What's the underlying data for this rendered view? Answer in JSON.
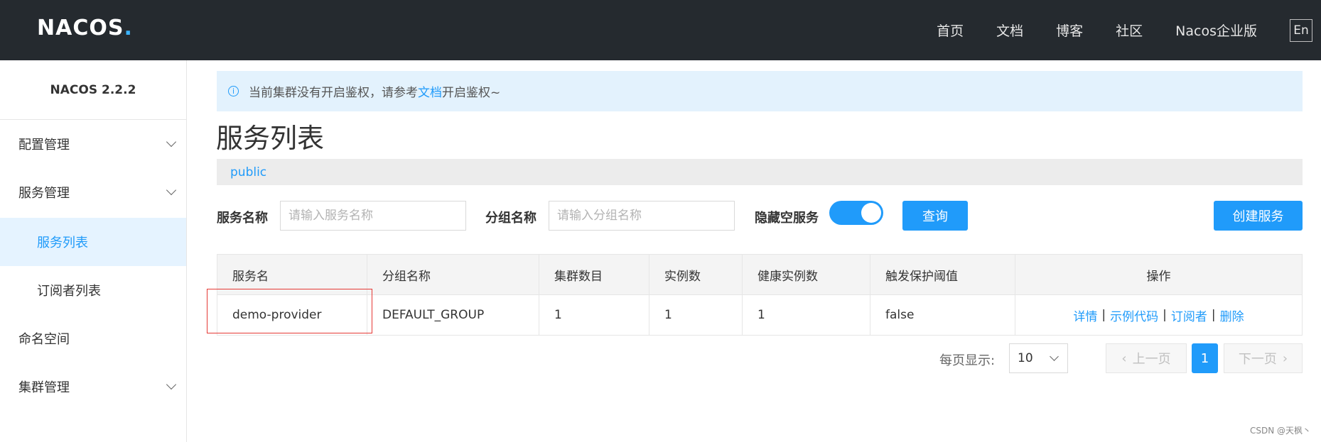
{
  "header": {
    "logo_text": "NACOS",
    "logo_dot": ".",
    "nav": [
      "首页",
      "文档",
      "博客",
      "社区",
      "Nacos企业版"
    ],
    "lang": "En"
  },
  "sidebar": {
    "version": "NACOS 2.2.2",
    "items": [
      {
        "label": "配置管理",
        "expandable": true
      },
      {
        "label": "服务管理",
        "expandable": true
      },
      {
        "label": "服务列表",
        "active": true
      },
      {
        "label": "订阅者列表"
      },
      {
        "label": "命名空间"
      },
      {
        "label": "集群管理",
        "expandable": true
      }
    ]
  },
  "notice": {
    "before": "当前集群没有开启鉴权，请参考",
    "link": "文档",
    "after": "开启鉴权~"
  },
  "page_title": "服务列表",
  "namespace": "public",
  "filters": {
    "service_name_label": "服务名称",
    "service_name_placeholder": "请输入服务名称",
    "group_name_label": "分组名称",
    "group_name_placeholder": "请输入分组名称",
    "hide_empty_label": "隐藏空服务",
    "hide_empty_on": true,
    "query_button": "查询",
    "create_button": "创建服务"
  },
  "table": {
    "headers": [
      "服务名",
      "分组名称",
      "集群数目",
      "实例数",
      "健康实例数",
      "触发保护阈值",
      "操作"
    ],
    "rows": [
      {
        "service": "demo-provider",
        "group": "DEFAULT_GROUP",
        "clusters": "1",
        "instances": "1",
        "healthy": "1",
        "threshold": "false",
        "ops": [
          "详情",
          "示例代码",
          "订阅者",
          "删除"
        ]
      }
    ]
  },
  "pagination": {
    "per_page_label": "每页显示:",
    "per_page_value": "10",
    "prev": "上一页",
    "current": "1",
    "next": "下一页"
  },
  "watermark": "CSDN @天枫丶",
  "colors": {
    "header_bg": "#252a2f",
    "accent": "#209bfa",
    "notice_bg": "#e3f2fd",
    "highlight": "#e53935"
  }
}
